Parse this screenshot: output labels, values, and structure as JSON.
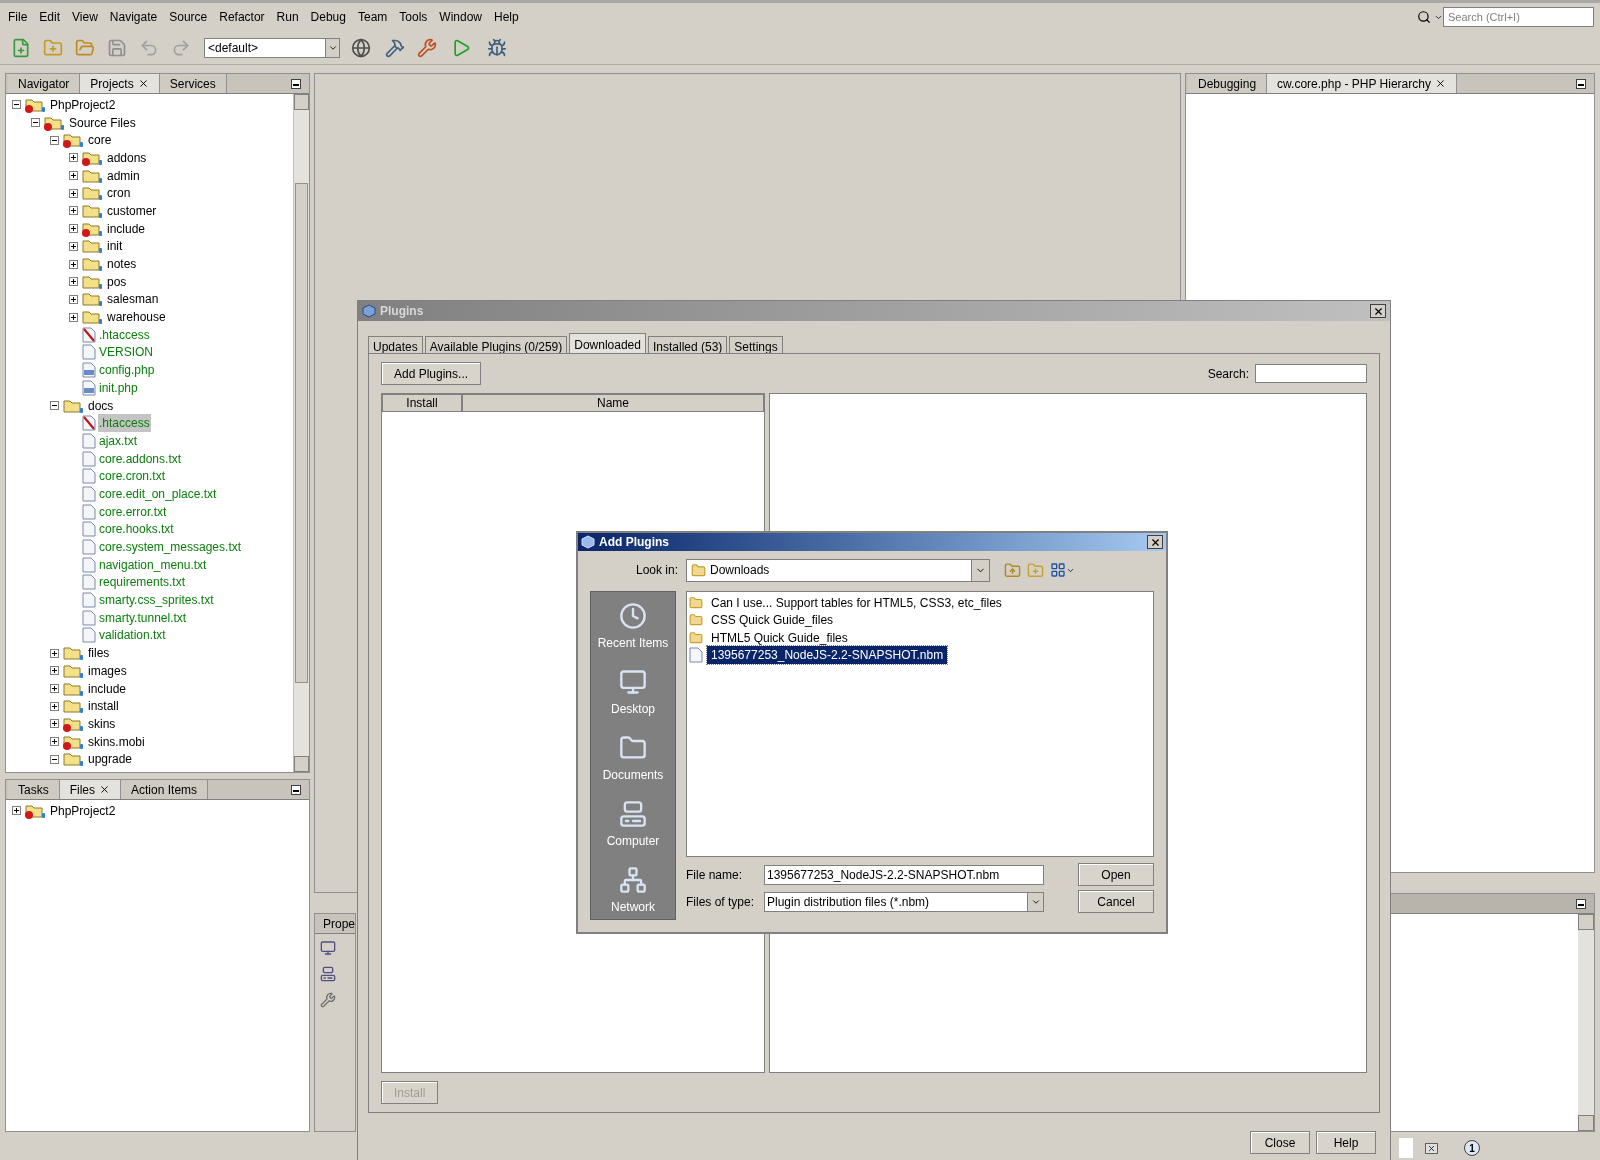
{
  "menu_bar": {
    "items": [
      "File",
      "Edit",
      "View",
      "Navigate",
      "Source",
      "Refactor",
      "Run",
      "Debug",
      "Team",
      "Tools",
      "Window",
      "Help"
    ]
  },
  "search": {
    "placeholder": "Search (Ctrl+I)"
  },
  "toolbar": {
    "configuration": "<default>"
  },
  "projects_panel": {
    "tabs": [
      {
        "label": "Navigator",
        "selected": false
      },
      {
        "label": "Projects",
        "selected": true
      },
      {
        "label": "Services",
        "selected": false
      }
    ],
    "tree": [
      {
        "label": "PhpProject2",
        "kind": "project",
        "expanded": true,
        "error": true,
        "selected": false,
        "children": [
          {
            "label": "Source Files",
            "kind": "sources",
            "expanded": true,
            "error": true,
            "selected": false,
            "children": [
              {
                "label": "core",
                "kind": "folder",
                "expanded": true,
                "error": true,
                "selected": false,
                "children": [
                  {
                    "label": "addons",
                    "kind": "folder",
                    "expanded": false,
                    "error": true,
                    "selected": false
                  },
                  {
                    "label": "admin",
                    "kind": "folder",
                    "expanded": false,
                    "error": false,
                    "selected": false
                  },
                  {
                    "label": "cron",
                    "kind": "folder",
                    "expanded": false,
                    "error": false,
                    "selected": false
                  },
                  {
                    "label": "customer",
                    "kind": "folder",
                    "expanded": false,
                    "error": false,
                    "selected": false
                  },
                  {
                    "label": "include",
                    "kind": "folder",
                    "expanded": false,
                    "error": true,
                    "selected": false
                  },
                  {
                    "label": "init",
                    "kind": "folder",
                    "expanded": false,
                    "error": false,
                    "selected": false
                  },
                  {
                    "label": "notes",
                    "kind": "folder",
                    "expanded": false,
                    "error": false,
                    "selected": false
                  },
                  {
                    "label": "pos",
                    "kind": "folder",
                    "expanded": false,
                    "error": false,
                    "selected": false
                  },
                  {
                    "label": "salesman",
                    "kind": "folder",
                    "expanded": false,
                    "error": false,
                    "selected": false
                  },
                  {
                    "label": "warehouse",
                    "kind": "folder",
                    "expanded": false,
                    "error": false,
                    "selected": false
                  },
                  {
                    "label": ".htaccess",
                    "kind": "config",
                    "error": false,
                    "selected": false
                  },
                  {
                    "label": "VERSION",
                    "kind": "text",
                    "error": false,
                    "selected": false
                  },
                  {
                    "label": "config.php",
                    "kind": "php",
                    "error": false,
                    "selected": false
                  },
                  {
                    "label": "init.php",
                    "kind": "php",
                    "error": false,
                    "selected": false
                  }
                ]
              },
              {
                "label": "docs",
                "kind": "folder",
                "expanded": true,
                "error": false,
                "selected": false,
                "children": [
                  {
                    "label": ".htaccess",
                    "kind": "config",
                    "error": false,
                    "selected": true
                  },
                  {
                    "label": "ajax.txt",
                    "kind": "text",
                    "error": false,
                    "selected": false
                  },
                  {
                    "label": "core.addons.txt",
                    "kind": "text",
                    "error": false,
                    "selected": false
                  },
                  {
                    "label": "core.cron.txt",
                    "kind": "text",
                    "error": false,
                    "selected": false
                  },
                  {
                    "label": "core.edit_on_place.txt",
                    "kind": "text",
                    "error": false,
                    "selected": false
                  },
                  {
                    "label": "core.error.txt",
                    "kind": "text",
                    "error": false,
                    "selected": false
                  },
                  {
                    "label": "core.hooks.txt",
                    "kind": "text",
                    "error": false,
                    "selected": false
                  },
                  {
                    "label": "core.system_messages.txt",
                    "kind": "text",
                    "error": false,
                    "selected": false
                  },
                  {
                    "label": "navigation_menu.txt",
                    "kind": "text",
                    "error": false,
                    "selected": false
                  },
                  {
                    "label": "requirements.txt",
                    "kind": "text",
                    "error": false,
                    "selected": false
                  },
                  {
                    "label": "smarty.css_sprites.txt",
                    "kind": "text",
                    "error": false,
                    "selected": false
                  },
                  {
                    "label": "smarty.tunnel.txt",
                    "kind": "text",
                    "error": false,
                    "selected": false
                  },
                  {
                    "label": "validation.txt",
                    "kind": "text",
                    "error": false,
                    "selected": false
                  }
                ]
              },
              {
                "label": "files",
                "kind": "folder",
                "expanded": false,
                "error": false,
                "selected": false
              },
              {
                "label": "images",
                "kind": "folder",
                "expanded": false,
                "error": false,
                "selected": false
              },
              {
                "label": "include",
                "kind": "folder",
                "expanded": false,
                "error": false,
                "selected": false
              },
              {
                "label": "install",
                "kind": "folder",
                "expanded": false,
                "error": false,
                "selected": false
              },
              {
                "label": "skins",
                "kind": "folder",
                "expanded": false,
                "error": true,
                "selected": false
              },
              {
                "label": "skins.mobi",
                "kind": "folder",
                "expanded": false,
                "error": true,
                "selected": false
              },
              {
                "label": "upgrade",
                "kind": "folder",
                "expanded": true,
                "error": false,
                "selected": false
              }
            ]
          }
        ]
      }
    ]
  },
  "files_panel": {
    "tabs": [
      {
        "label": "Tasks",
        "selected": false
      },
      {
        "label": "Files",
        "selected": true
      },
      {
        "label": "Action Items",
        "selected": false
      }
    ],
    "tree": [
      {
        "label": "PhpProject2",
        "kind": "folder",
        "expanded": false,
        "error": true,
        "selected": false
      }
    ]
  },
  "properties_panel": {
    "tab": "Prope"
  },
  "editor_panel": {
    "tabs": [
      {
        "label": "Debugging",
        "selected": false
      },
      {
        "label": "cw.core.php - PHP Hierarchy",
        "selected": true
      }
    ]
  },
  "status_bar": {
    "notifications": "1"
  },
  "plugins_dialog": {
    "title": "Plugins",
    "tabs": [
      {
        "label": "Updates",
        "selected": false
      },
      {
        "label": "Available Plugins (0/259)",
        "selected": false
      },
      {
        "label": "Downloaded",
        "selected": true
      },
      {
        "label": "Installed (53)",
        "selected": false
      },
      {
        "label": "Settings",
        "selected": false
      }
    ],
    "add_button": "Add Plugins...",
    "search_label": "Search:",
    "columns": [
      "Install",
      "Name"
    ],
    "install_button": {
      "label": "Install",
      "disabled": true
    },
    "buttons": [
      "Close",
      "Help"
    ]
  },
  "add_plugins_dialog": {
    "title": "Add Plugins",
    "look_in_label": "Look in:",
    "look_in": "Downloads",
    "places": [
      {
        "label": "Recent Items",
        "kind": "recent"
      },
      {
        "label": "Desktop",
        "kind": "desktop"
      },
      {
        "label": "Documents",
        "kind": "documents"
      },
      {
        "label": "Computer",
        "kind": "computer"
      },
      {
        "label": "Network",
        "kind": "network"
      }
    ],
    "files": [
      {
        "name": "Can I use... Support tables for HTML5, CSS3, etc_files",
        "kind": "folder",
        "selected": false
      },
      {
        "name": "CSS Quick Guide_files",
        "kind": "folder",
        "selected": false
      },
      {
        "name": "HTML5 Quick Guide_files",
        "kind": "folder",
        "selected": false
      },
      {
        "name": "1395677253_NodeJS-2.2-SNAPSHOT.nbm",
        "kind": "file",
        "selected": true
      }
    ],
    "file_name_label": "File name:",
    "file_name": "1395677253_NodeJS-2.2-SNAPSHOT.nbm",
    "file_type_label": "Files of type:",
    "file_type": "Plugin distribution files (*.nbm)",
    "buttons": [
      "Open",
      "Cancel"
    ]
  }
}
